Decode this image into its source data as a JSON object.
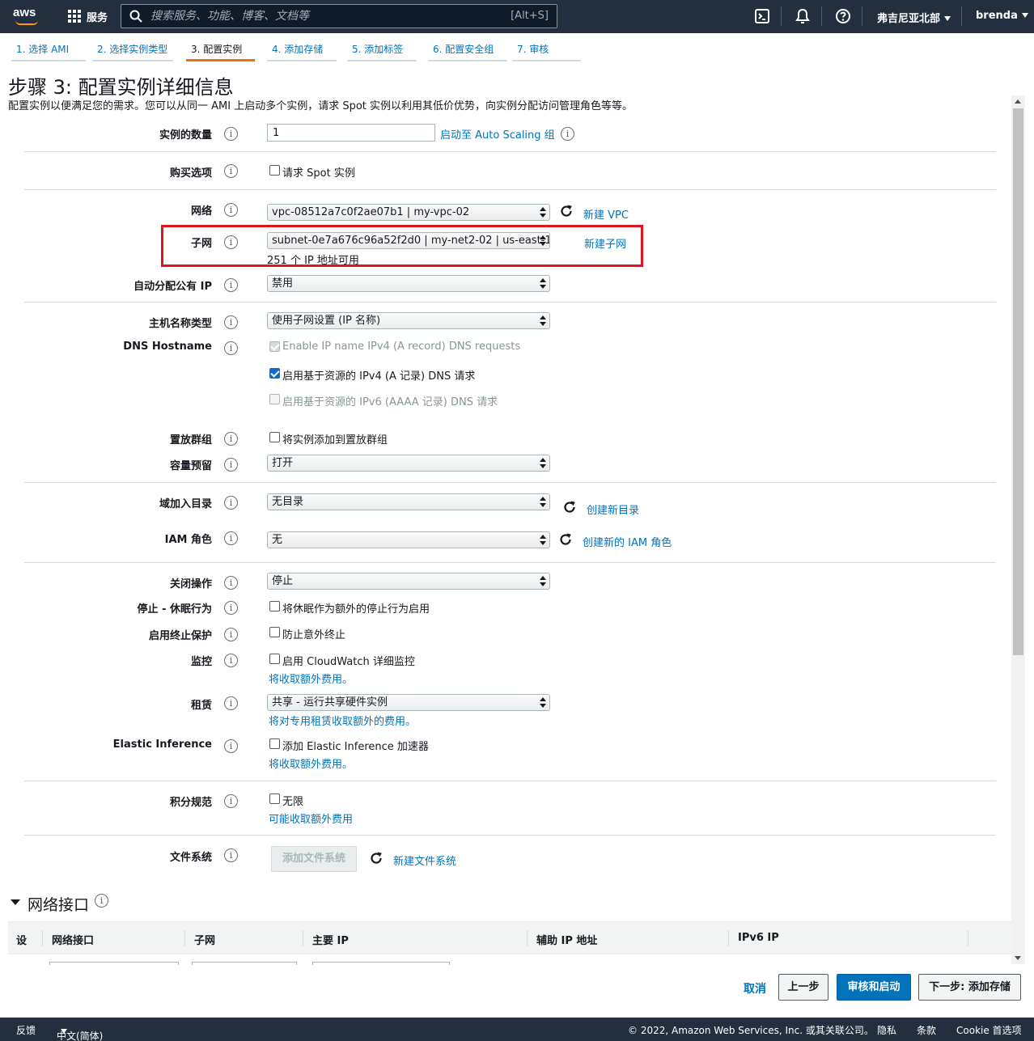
{
  "topnav": {
    "logo": "aws",
    "services_label": "服务",
    "search_placeholder": "搜索服务、功能、博客、文档等",
    "search_shortcut": "[Alt+S]",
    "region": "弗吉尼亚北部",
    "user": "brenda",
    "icons": [
      "terminal-icon",
      "bell-icon",
      "help-icon"
    ]
  },
  "tabs": [
    {
      "label": "1. 选择 AMI",
      "active": false
    },
    {
      "label": "2. 选择实例类型",
      "active": false
    },
    {
      "label": "3. 配置实例",
      "active": true
    },
    {
      "label": "4. 添加存储",
      "active": false
    },
    {
      "label": "5. 添加标签",
      "active": false
    },
    {
      "label": "6. 配置安全组",
      "active": false
    },
    {
      "label": "7. 审核",
      "active": false
    }
  ],
  "page": {
    "title": "步骤 3: 配置实例详细信息",
    "description": "配置实例以便满足您的需求。您可以从同一 AMI 上启动多个实例，请求 Spot 实例以利用其低价优势，向实例分配访问管理角色等等。"
  },
  "form": {
    "instance_count": {
      "label": "实例的数量",
      "value": "1",
      "link": "启动至 Auto Scaling 组"
    },
    "purchase": {
      "label": "购买选项",
      "checkbox": "请求 Spot 实例",
      "checked": false
    },
    "network": {
      "label": "网络",
      "value": "vpc-08512a7c0f2ae07b1 | my-vpc-02",
      "link": "新建 VPC"
    },
    "subnet": {
      "label": "子网",
      "value": "subnet-0e7a676c96a52f2d0 | my-net2-02 | us-east-1",
      "hint": "251 个 IP 地址可用",
      "link": "新建子网"
    },
    "public_ip": {
      "label": "自动分配公有 IP",
      "value": "禁用"
    },
    "hostname_type": {
      "label": "主机名称类型",
      "value": "使用子网设置 (IP 名称)"
    },
    "dns_hostname": {
      "label": "DNS Hostname",
      "options": [
        {
          "label": "Enable IP name IPv4 (A record) DNS requests",
          "checked": true,
          "disabled": true
        },
        {
          "label": "启用基于资源的 IPv4 (A 记录) DNS 请求",
          "checked": true,
          "disabled": false
        },
        {
          "label": "启用基于资源的 IPv6 (AAAA 记录) DNS 请求",
          "checked": false,
          "disabled": true
        }
      ]
    },
    "placement_group": {
      "label": "置放群组",
      "checkbox": "将实例添加到置放群组",
      "checked": false
    },
    "capacity_reservation": {
      "label": "容量预留",
      "value": "打开"
    },
    "domain_join": {
      "label": "域加入目录",
      "value": "无目录",
      "link": "创建新目录"
    },
    "iam_role": {
      "label": "IAM 角色",
      "value": "无",
      "link": "创建新的 IAM 角色"
    },
    "shutdown": {
      "label": "关闭操作",
      "value": "停止"
    },
    "hibernate": {
      "label": "停止 - 休眠行为",
      "checkbox": "将休眠作为额外的停止行为启用",
      "checked": false
    },
    "termination": {
      "label": "启用终止保护",
      "checkbox": "防止意外终止",
      "checked": false
    },
    "monitoring": {
      "label": "监控",
      "checkbox": "启用 CloudWatch 详细监控",
      "checked": false,
      "link": "将收取额外费用。"
    },
    "tenancy": {
      "label": "租赁",
      "value": "共享 - 运行共享硬件实例",
      "link": "将对专用租赁收取额外的费用。"
    },
    "elastic_inference": {
      "label": "Elastic Inference",
      "checkbox": "添加 Elastic Inference 加速器",
      "checked": false,
      "link": "将收取额外费用。"
    },
    "credit": {
      "label": "积分规范",
      "checkbox": "无限",
      "checked": false,
      "link": "可能收取额外费用"
    },
    "file_systems": {
      "label": "文件系统",
      "button": "添加文件系统",
      "link": "新建文件系统"
    }
  },
  "network_interfaces": {
    "title": "网络接口",
    "columns": [
      "设",
      "网络接口",
      "子网",
      "主要 IP",
      "辅助 IP 地址",
      "IPv6 IP"
    ]
  },
  "actions": {
    "cancel": "取消",
    "previous": "上一步",
    "review_launch": "审核和启动",
    "next": "下一步: 添加存储"
  },
  "footer": {
    "feedback": "反馈",
    "language": "中文(简体)",
    "copyright": "© 2022, Amazon Web Services, Inc. 或其关联公司。",
    "privacy": "隐私",
    "terms": "条款",
    "cookie": "Cookie 首选项"
  },
  "colors": {
    "nav_bg": "#232f3e",
    "link": "#0073bb",
    "primary_button": "#0073bb",
    "active_tab": "#ec7211",
    "highlight_box": "#e0141e"
  }
}
